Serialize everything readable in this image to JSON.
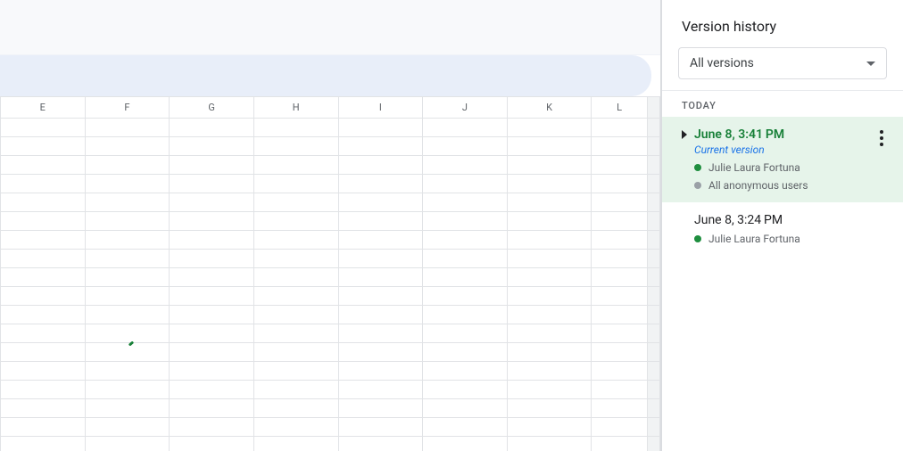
{
  "panel": {
    "title": "Version history",
    "filter_label": "All versions",
    "section_label": "TODAY"
  },
  "versions": [
    {
      "time": "June 8, 3:41 PM",
      "subtitle": "Current version",
      "editors": [
        {
          "name": "Julie Laura Fortuna",
          "color": "#1e8e3e"
        },
        {
          "name": "All anonymous users",
          "color": "#9aa0a6"
        }
      ]
    },
    {
      "time": "June 8, 3:24 PM",
      "editors": [
        {
          "name": "Julie Laura Fortuna",
          "color": "#1e8e3e"
        }
      ]
    }
  ],
  "columns": [
    "E",
    "F",
    "G",
    "H",
    "I",
    "J",
    "K",
    "L"
  ]
}
